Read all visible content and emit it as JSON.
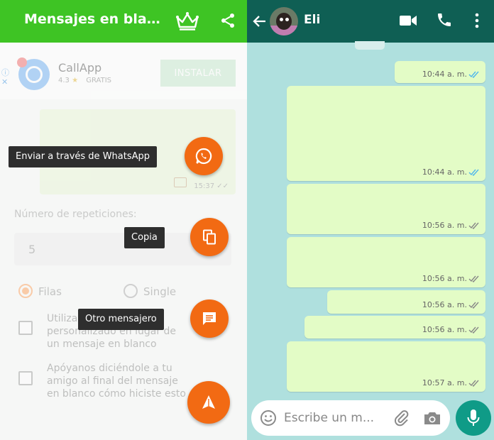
{
  "left": {
    "title": "Mensajes en blanco",
    "ad": {
      "info": "ⓘ\n✕",
      "app_name": "CallApp",
      "rating": "4.3",
      "star": "★",
      "price": "GRATIS",
      "install_label": "INSTALAR"
    },
    "preview_time": "15:37 ✓✓",
    "repetitions_label": "Número de repeticiones:",
    "repetitions_value": "5",
    "mode_rows_label": "Filas",
    "mode_single_label": "Single",
    "option_custom_text": "Utilizar un mensaje personalizado en lugar de un mensaje en blanco",
    "option_support_text": "Apóyanos diciéndole a tu amigo al final del mensaje en blanco cómo hiciste esto",
    "tips": {
      "whatsapp": "Enviar a través de WhatsApp",
      "copy": "Copia",
      "other": "Otro mensajero"
    }
  },
  "right": {
    "contact_name": "Eli",
    "messages": [
      {
        "time": "10:44 a. m.",
        "read": true
      },
      {
        "time": "10:44 a. m.",
        "read": true
      },
      {
        "time": "10:56 a. m.",
        "read": false
      },
      {
        "time": "10:56 a. m.",
        "read": false
      },
      {
        "time": "10:56 a. m.",
        "read": false
      },
      {
        "time": "10:56 a. m.",
        "read": false
      },
      {
        "time": "10:57 a. m.",
        "read": false
      }
    ],
    "compose_placeholder": "Escribe un m..."
  },
  "colors": {
    "left_header": "#3ec424",
    "accent_orange": "#f26a13",
    "whatsapp_header": "#0f5f54",
    "chat_background": "#afe0de",
    "outgoing_bubble": "#e3fcc6",
    "read_tick": "#4fb6ec",
    "mic_button": "#0f9b87"
  },
  "icons": [
    "crown-icon",
    "share-icon",
    "whatsapp-icon",
    "copy-icon",
    "chat-icon",
    "navigation-icon",
    "back-arrow-icon",
    "video-call-icon",
    "phone-icon",
    "more-vert-icon",
    "emoji-icon",
    "attach-icon",
    "camera-icon",
    "mic-icon",
    "double-check-icon"
  ]
}
